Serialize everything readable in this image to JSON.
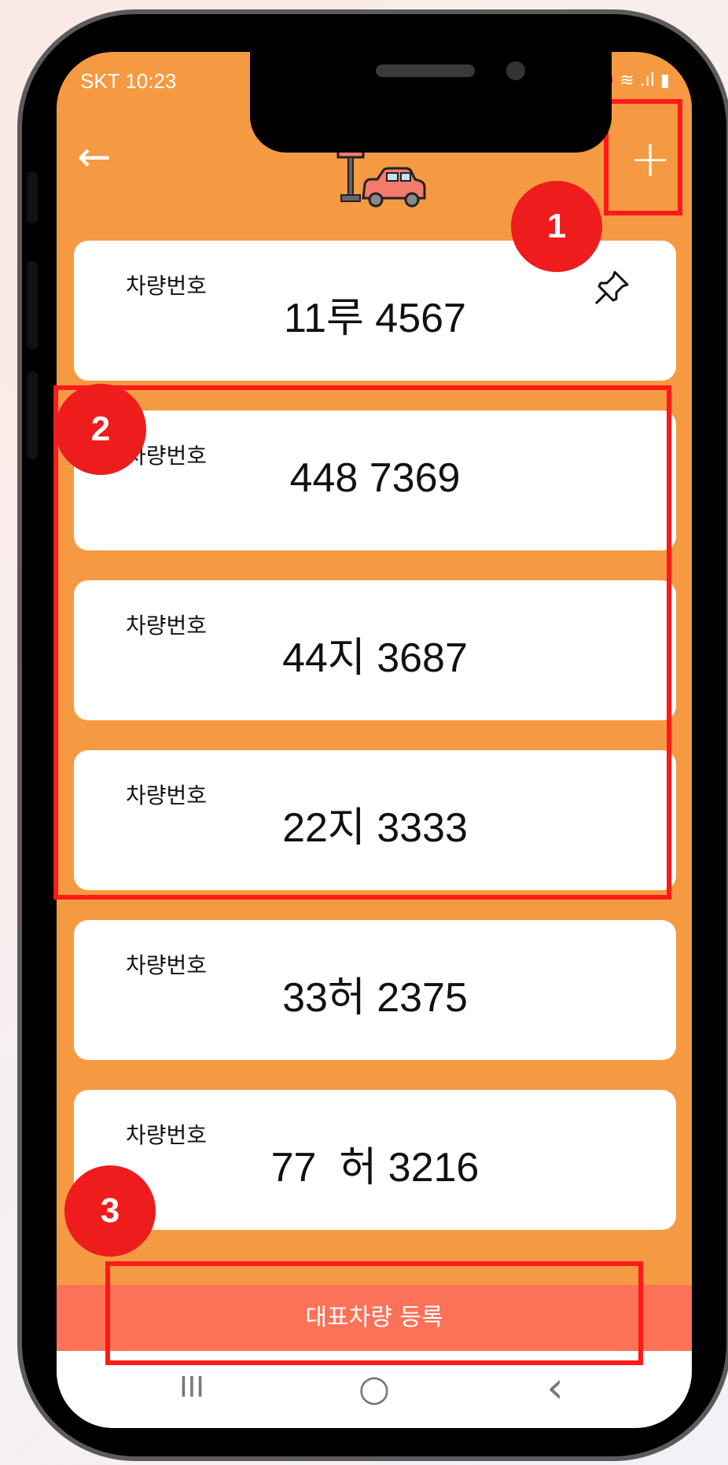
{
  "status_bar": {
    "carrier_time": "SKT 10:23",
    "indicators": "🔇 ≋ .ıl ▮"
  },
  "header": {
    "back_icon": "arrow-left-icon",
    "logo_icon": "parking-car-icon",
    "add_icon": "plus-icon",
    "add_symbol": "+",
    "back_symbol": "←"
  },
  "vehicles": [
    {
      "label": "차량번호",
      "number": "11루 4567",
      "pinned": true
    },
    {
      "label": "차량번호",
      "number": "448 7369"
    },
    {
      "label": "차량번호",
      "number": "44지 3687"
    },
    {
      "label": "차량번호",
      "number": "22지 3333"
    },
    {
      "label": "차량번호",
      "number": "33허 2375"
    },
    {
      "label": "차량번호",
      "number": "77  허 3216"
    }
  ],
  "primary_button": {
    "label": "대표차량 등록"
  },
  "nav": {
    "recent": "III",
    "home": "○",
    "back": "‹"
  },
  "annotations": {
    "badge1": "1",
    "badge2": "2",
    "badge3": "3"
  },
  "colors": {
    "app_bg": "#f59a42",
    "button_bg": "#fc7258",
    "annotation_red": "#ee1c1c"
  }
}
